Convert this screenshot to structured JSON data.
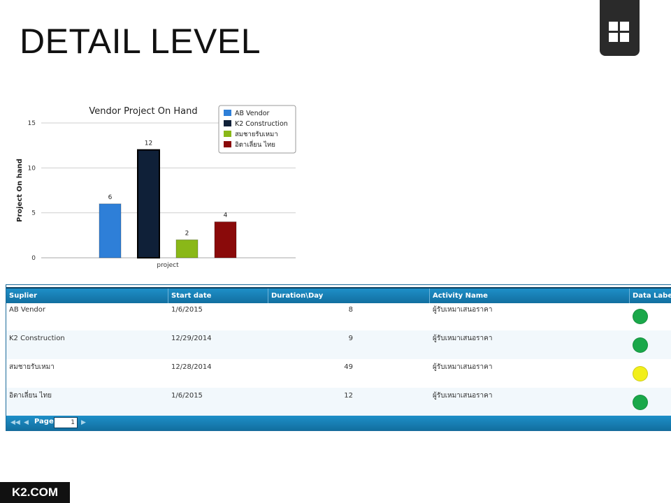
{
  "slide": {
    "title": "DETAIL LEVEL",
    "brand": "K2.COM"
  },
  "chart_data": {
    "type": "bar",
    "title": "Vendor Project On Hand",
    "xlabel": "project",
    "ylabel": "Project On hand",
    "ylim": [
      0,
      15
    ],
    "yticks": [
      0,
      5,
      10,
      15
    ],
    "grid": true,
    "legend_position": "top-right",
    "categories": [
      "project"
    ],
    "series": [
      {
        "name": "AB Vendor",
        "values": [
          6
        ],
        "color": "#2e7fd8"
      },
      {
        "name": "K2 Construction",
        "values": [
          12
        ],
        "color": "#0f2038"
      },
      {
        "name": "สมชายรับเหมา",
        "values": [
          2
        ],
        "color": "#8ab818"
      },
      {
        "name": "อิตาเลี่ยน ไทย",
        "values": [
          4
        ],
        "color": "#8a0a0a"
      }
    ]
  },
  "grid": {
    "columns": [
      "Suplier",
      "Start date",
      "Duration\\Day",
      "Activity Name",
      "Data Label"
    ],
    "rows": [
      {
        "supplier": "AB Vendor",
        "start": "1/6/2015",
        "duration": "8",
        "activity": "ผู้รับเหมาเสนอราคา",
        "status_color": "#1aa84a"
      },
      {
        "supplier": "K2 Construction",
        "start": "12/29/2014",
        "duration": "9",
        "activity": "ผู้รับเหมาเสนอราคา",
        "status_color": "#1aa84a"
      },
      {
        "supplier": "สมชายรับเหมา",
        "start": "12/28/2014",
        "duration": "49",
        "activity": "ผู้รับเหมาเสนอราคา",
        "status_color": "#f2ef1a"
      },
      {
        "supplier": "อิตาเลี่ยน ไทย",
        "start": "1/6/2015",
        "duration": "12",
        "activity": "ผู้รับเหมาเสนอราคา",
        "status_color": "#1aa84a"
      }
    ],
    "pager": {
      "label": "Page",
      "value": "1"
    }
  }
}
